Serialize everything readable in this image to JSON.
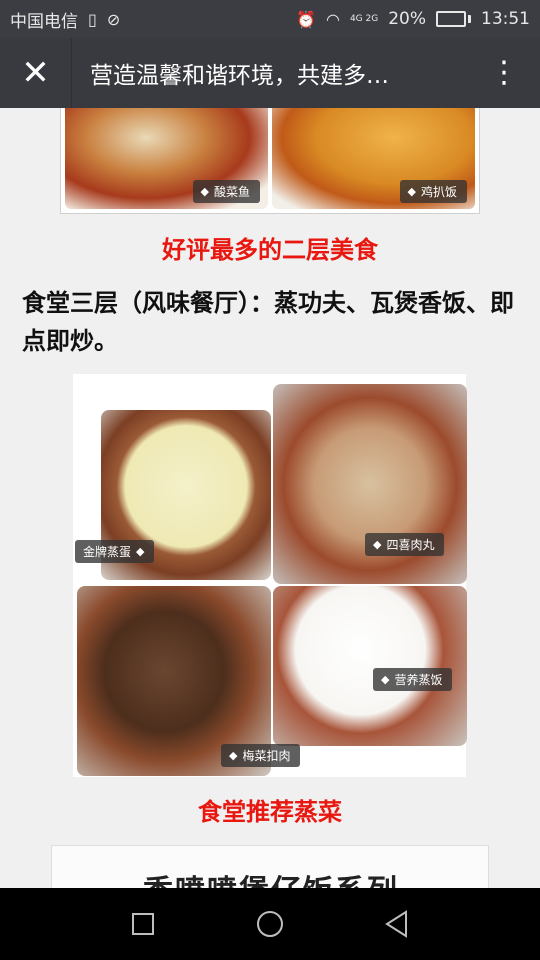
{
  "status_bar": {
    "carrier": "中国电信",
    "signal_type": "4G 2G",
    "battery_percent": "20%",
    "battery_level": 0.2,
    "time": "13:51"
  },
  "title_bar": {
    "title": "营造温馨和谐环境，共建多…"
  },
  "photo_top": {
    "tags": [
      "酸菜鱼",
      "鸡扒饭"
    ]
  },
  "caption1": "好评最多的二层美食",
  "paragraph": "食堂三层（风味餐厅）：蒸功夫、瓦煲香饭、即点即炒。",
  "photo_grid": {
    "tags": {
      "egg": "金牌蒸蛋",
      "meatball": "四喜肉丸",
      "rice": "营养蒸饭",
      "pork": "梅菜扣肉"
    }
  },
  "caption2": "食堂推荐蒸菜",
  "photo_bottom": {
    "banner": "香喷喷煲仔饭系列"
  },
  "icons": {
    "close": "close-icon",
    "more": "more-vertical-icon",
    "back": "back-triangle-icon",
    "home": "home-circle-icon",
    "recent": "recent-square-icon"
  },
  "colors": {
    "caption": "#e8170f",
    "title_bar": "#393a3f"
  }
}
